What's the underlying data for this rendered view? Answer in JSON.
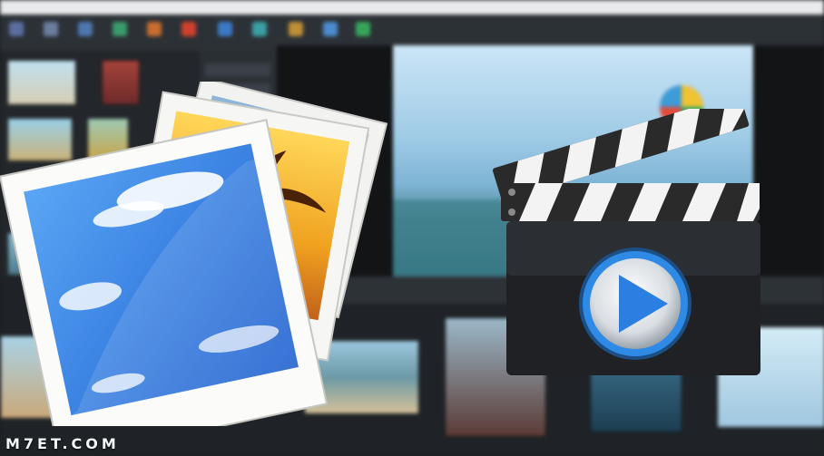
{
  "watermark": {
    "text": "M7ET.COM"
  },
  "colors": {
    "background": "#1c1f22",
    "play_button": "#2f8ae6",
    "sky": "#3f7fe0",
    "sunset": "#f0a21f"
  },
  "icons": [
    "photo-stack-icon",
    "clapperboard-icon",
    "play-icon"
  ]
}
